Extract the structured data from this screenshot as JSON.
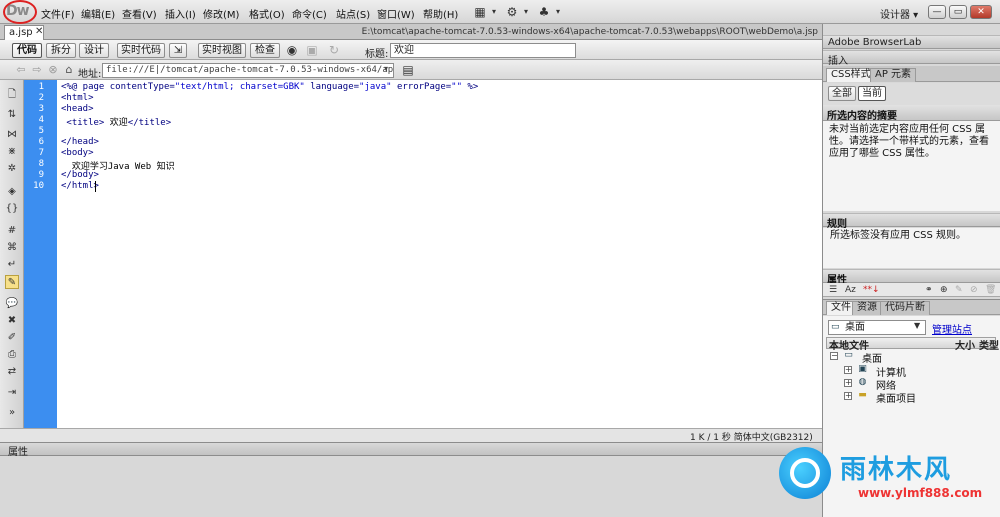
{
  "app": {
    "logo": "Dw",
    "workspace": "设计器 ▾",
    "window_buttons": [
      "—",
      "▭",
      "✕"
    ]
  },
  "menu": [
    "文件(F)",
    "编辑(E)",
    "查看(V)",
    "插入(I)",
    "修改(M)",
    "格式(O)",
    "命令(C)",
    "站点(S)",
    "窗口(W)",
    "帮助(H)"
  ],
  "document": {
    "tab": "a.jsp",
    "path": "E:\\tomcat\\apache-tomcat-7.0.53-windows-x64\\apache-tomcat-7.0.53\\webapps\\ROOT\\webDemo\\a.jsp"
  },
  "doc_toolbar": {
    "code": "代码",
    "split": "拆分",
    "design": "设计",
    "live_code": "实时代码",
    "live_view": "实时视图",
    "inspect": "检查",
    "title_label": "标题:",
    "title_value": "欢迎"
  },
  "address": {
    "label": "地址:",
    "value": "file:///E|/tomcat/apache-tomcat-7.0.53-windows-x64/apache-tomca"
  },
  "code_lines": [
    [
      "kw",
      "<%@ page contentType="
    ],
    [
      "str",
      "\"text/html; charset=GBK\""
    ],
    [
      "kw",
      " language="
    ],
    [
      "str",
      "\"java\""
    ],
    [
      "kw",
      " errorPage="
    ],
    [
      "str",
      "\"\""
    ],
    [
      "kw",
      " %>"
    ]
  ],
  "code_text": {
    "l2": "<html>",
    "l3": "<head>",
    "l4a": " <title>",
    "l4b": " 欢迎",
    "l4c": "</title>",
    "l6": "</head>",
    "l7": "<body>",
    "l8": "  欢迎学习Java Web 知识",
    "l9": "</body>",
    "l10": "</html>"
  },
  "line_numbers": [
    "1",
    "2",
    "3",
    "4",
    "5",
    "6",
    "7",
    "8",
    "9",
    "10"
  ],
  "status": {
    "text": "1 K / 1 秒  简体中文(GB2312)"
  },
  "bottom_panel": {
    "label": "属性"
  },
  "right_panel": {
    "browserlab": "Adobe BrowserLab",
    "insert": "插入",
    "tabs": [
      "CSS样式",
      "AP 元素"
    ],
    "mode_all": "全部",
    "mode_current": "当前",
    "summary_title": "所选内容的摘要",
    "summary_text": "未对当前选定内容应用任何 CSS 属性。请选择一个带样式的元素，查看应用了哪些 CSS 属性。",
    "rules_title": "规则",
    "rules_text": "所选标签没有应用 CSS 规则。",
    "props_title": "属性",
    "files_tabs": [
      "文件",
      "资源",
      "代码片断"
    ],
    "site_select": "桌面",
    "manage_site": "管理站点",
    "files_header": [
      "本地文件",
      "大小",
      "类型"
    ],
    "tree": [
      "桌面",
      "计算机",
      "网络",
      "桌面项目"
    ]
  },
  "watermark": {
    "brand": "雨林木风",
    "url": "www.ylmf888.com"
  }
}
